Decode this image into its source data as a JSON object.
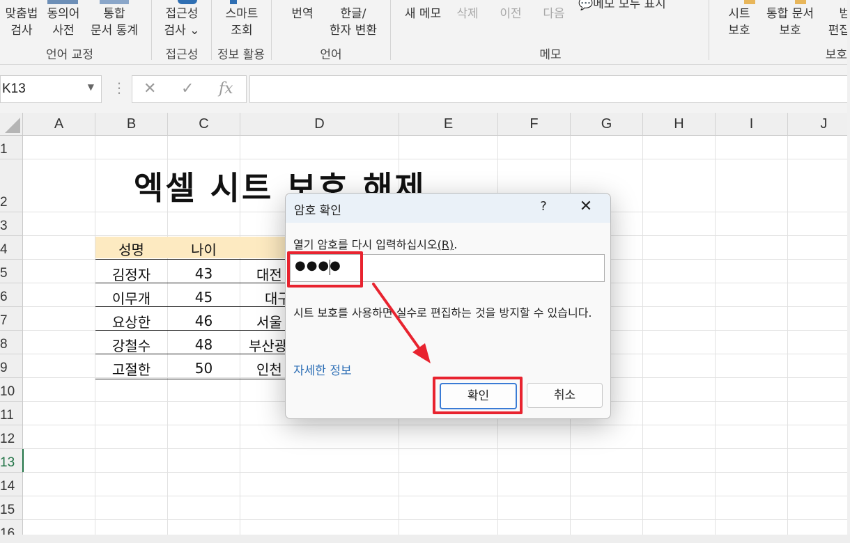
{
  "ribbon": {
    "proofing": {
      "spell_label": "맞춤법\n검사",
      "thesaurus_label": "동의어\n사전",
      "workbook_stats_label": "통합\n문서 통계",
      "group_label": "언어 교정"
    },
    "accessibility": {
      "check_label": "접근성\n검사 ⌄",
      "group_label": "접근성"
    },
    "insights": {
      "smart_lookup_label": "스마트\n조회",
      "group_label": "정보 활용"
    },
    "language": {
      "translate_label": "번역",
      "hanja_label": "한글/\n한자 변환",
      "group_label": "언어"
    },
    "comments": {
      "new_label": "새 메모",
      "delete_label": "삭제",
      "prev_label": "이전",
      "next_label": "다음",
      "show_all_label": "메모 모두 표시",
      "group_label": "메모"
    },
    "protect": {
      "protect_sheet_label": "시트\n보호",
      "protect_workbook_label": "통합 문서\n보호",
      "allow_edit_label": "범\n편집",
      "group_label": "보호"
    }
  },
  "formula_bar": {
    "name_box": "K13",
    "cancel_glyph": "✕",
    "enter_glyph": "✓",
    "fx_glyph": "fx",
    "formula_value": ""
  },
  "grid": {
    "columns": [
      "A",
      "B",
      "C",
      "D",
      "E",
      "F",
      "G",
      "H",
      "I",
      "J"
    ],
    "rows": [
      "1",
      "2",
      "3",
      "4",
      "5",
      "6",
      "7",
      "8",
      "9",
      "10",
      "11",
      "12",
      "13",
      "14",
      "15",
      "16"
    ],
    "active_row": "13"
  },
  "sheet": {
    "title": "엑셀 시트 보호 해제",
    "table": {
      "headers": [
        "성명",
        "나이"
      ],
      "rows": [
        {
          "name": "김정자",
          "age": "43",
          "place": "대전"
        },
        {
          "name": "이무개",
          "age": "45",
          "place": "대구"
        },
        {
          "name": "요상한",
          "age": "46",
          "place": "서울"
        },
        {
          "name": "강철수",
          "age": "48",
          "place": "부산광"
        },
        {
          "name": "고절한",
          "age": "50",
          "place": "인천"
        }
      ]
    }
  },
  "dialog": {
    "title": "암호 확인",
    "help_glyph": "?",
    "close_glyph": "✕",
    "prompt_text": "열기 암호를 다시 입력하십시오",
    "prompt_hotkey": "(R)",
    "prompt_end": ".",
    "password_value": "●●●●",
    "info_text": "시트 보호를 사용하면 실수로 편집하는 것을 방지할 수 있습니다.",
    "link_text": "자세한 정보",
    "ok_label": "확인",
    "cancel_label": "취소"
  },
  "colors": {
    "annotation_red": "#e8232f",
    "table_header_fill": "#fdeac1",
    "excel_green": "#217346",
    "link_blue": "#2a6db5"
  }
}
